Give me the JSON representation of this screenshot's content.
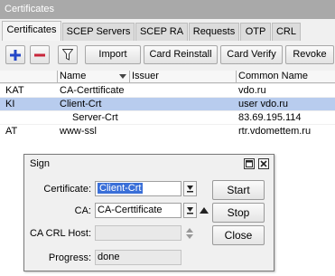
{
  "window": {
    "title": "Certificates"
  },
  "tabs": [
    "Certificates",
    "SCEP Servers",
    "SCEP RA",
    "Requests",
    "OTP",
    "CRL"
  ],
  "toolbar": {
    "add_icon": "plus-icon",
    "remove_icon": "minus-icon",
    "filter_icon": "filter-icon",
    "import_label": "Import",
    "card_reinstall_label": "Card Reinstall",
    "card_verify_label": "Card Verify",
    "revoke_label": "Revoke"
  },
  "table": {
    "columns": [
      "Name",
      "Issuer",
      "Common Name"
    ],
    "rows": [
      {
        "flags": "KAT",
        "name": "CA-Certtificate",
        "issuer": "",
        "common_name": "vdo.ru"
      },
      {
        "flags": "KI",
        "name": "Client-Crt",
        "issuer": "",
        "common_name": "user vdo.ru"
      },
      {
        "flags": "",
        "name": "Server-Crt",
        "issuer": "",
        "common_name": "83.69.195.114"
      },
      {
        "flags": "AT",
        "name": "www-ssl",
        "issuer": "",
        "common_name": "rtr.vdomettem.ru"
      }
    ]
  },
  "dialog": {
    "title": "Sign",
    "certificate_label": "Certificate:",
    "certificate_value": "Client-Crt",
    "ca_label": "CA:",
    "ca_value": "CA-Certtificate",
    "ca_crl_host_label": "CA CRL Host:",
    "ca_crl_host_value": "",
    "progress_label": "Progress:",
    "progress_value": "done",
    "start_label": "Start",
    "stop_label": "Stop",
    "close_label": "Close"
  },
  "colors": {
    "selected_row": "#b8ccee",
    "titlebar": "#a9a9a9",
    "add": "#2346c7",
    "remove": "#c8263a"
  }
}
